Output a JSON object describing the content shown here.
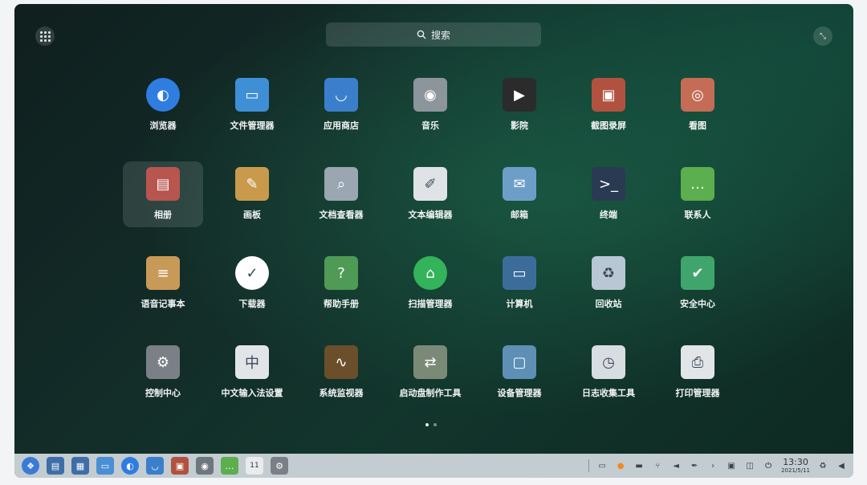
{
  "search": {
    "label": "搜索"
  },
  "apps": [
    {
      "id": "browser",
      "label": "浏览器",
      "icon": "browser-icon",
      "color": "#2f7de1"
    },
    {
      "id": "file-manager",
      "label": "文件管理器",
      "icon": "folder-icon",
      "color": "#3f8fd6"
    },
    {
      "id": "app-store",
      "label": "应用商店",
      "icon": "shopping-bag-icon",
      "color": "#3b7fcc"
    },
    {
      "id": "music",
      "label": "音乐",
      "icon": "disc-icon",
      "color": "#8d959c"
    },
    {
      "id": "movie",
      "label": "影院",
      "icon": "clapperboard-icon",
      "color": "#2b2b2b"
    },
    {
      "id": "screenshot",
      "label": "截图录屏",
      "icon": "screenshot-icon",
      "color": "#b0523f"
    },
    {
      "id": "image-viewer",
      "label": "看图",
      "icon": "image-viewer-icon",
      "color": "#c46c55"
    },
    {
      "id": "album",
      "label": "相册",
      "icon": "photo-album-icon",
      "color": "#b8554f",
      "selected": true
    },
    {
      "id": "draw",
      "label": "画板",
      "icon": "palette-icon",
      "color": "#c99a4c"
    },
    {
      "id": "doc-viewer",
      "label": "文档查看器",
      "icon": "document-search-icon",
      "color": "#9aa6b0"
    },
    {
      "id": "text-editor",
      "label": "文本编辑器",
      "icon": "text-editor-icon",
      "color": "#dfe3e6"
    },
    {
      "id": "mail",
      "label": "邮箱",
      "icon": "mail-icon",
      "color": "#6d9ec8"
    },
    {
      "id": "terminal",
      "label": "终端",
      "icon": "terminal-icon",
      "color": "#2a3a52"
    },
    {
      "id": "contacts",
      "label": "联系人",
      "icon": "chat-icon",
      "color": "#5cae4f"
    },
    {
      "id": "voice-note",
      "label": "语音记事本",
      "icon": "notepad-icon",
      "color": "#c89a58"
    },
    {
      "id": "downloader",
      "label": "下载器",
      "icon": "download-icon",
      "color": "#ffffff"
    },
    {
      "id": "help",
      "label": "帮助手册",
      "icon": "help-book-icon",
      "color": "#4f9a55"
    },
    {
      "id": "scanner",
      "label": "扫描管理器",
      "icon": "scanner-icon",
      "color": "#33b35a"
    },
    {
      "id": "computer",
      "label": "计算机",
      "icon": "monitor-icon",
      "color": "#3c6d9a"
    },
    {
      "id": "trash",
      "label": "回收站",
      "icon": "trash-icon",
      "color": "#b9c7d4"
    },
    {
      "id": "security",
      "label": "安全中心",
      "icon": "shield-check-icon",
      "color": "#3fa56c"
    },
    {
      "id": "control-center",
      "label": "控制中心",
      "icon": "gear-icon",
      "color": "#7b8086"
    },
    {
      "id": "input-method",
      "label": "中文输入法设置",
      "icon": "keyboard-icon",
      "color": "#e2e5e8"
    },
    {
      "id": "system-monitor",
      "label": "系统监视器",
      "icon": "system-monitor-icon",
      "color": "#6b4e2a"
    },
    {
      "id": "boot-maker",
      "label": "启动盘制作工具",
      "icon": "usb-icon",
      "color": "#7b8a76"
    },
    {
      "id": "device-manager",
      "label": "设备管理器",
      "icon": "device-icon",
      "color": "#5e8fb5"
    },
    {
      "id": "log-viewer",
      "label": "日志收集工具",
      "icon": "log-icon",
      "color": "#d8dde2"
    },
    {
      "id": "print-manager",
      "label": "打印管理器",
      "icon": "printer-icon",
      "color": "#e2e5e8"
    }
  ],
  "pager": {
    "count": 2,
    "active": 0
  },
  "dock": {
    "items": [
      {
        "icon": "launcher-icon",
        "color": "#3a7bd5"
      },
      {
        "icon": "multitask-icon",
        "color": "#3d6ea8"
      },
      {
        "icon": "workspace-icon",
        "color": "#3d6ea8"
      },
      {
        "icon": "folder-icon",
        "color": "#4a8fd4"
      },
      {
        "icon": "browser-icon",
        "color": "#2f7de1"
      },
      {
        "icon": "app-store-icon",
        "color": "#3b7fcc"
      },
      {
        "icon": "screenshot-icon",
        "color": "#b0523f"
      },
      {
        "icon": "music-icon",
        "color": "#6f777e"
      },
      {
        "icon": "chat-icon",
        "color": "#5cae4f"
      },
      {
        "icon": "calendar-icon",
        "color": "#e8ecef"
      },
      {
        "icon": "settings-icon",
        "color": "#7b8086"
      }
    ],
    "calendar_day": "11",
    "tray": [
      "screen-icon",
      "fire-icon",
      "keyboard-icon",
      "usb-icon",
      "volume-icon",
      "pen-icon",
      "chevron-right-icon",
      "window-icon",
      "cpu-icon",
      "power-icon"
    ],
    "clock_time": "13:30",
    "clock_date": "2021/5/11",
    "tray_end": [
      "trash-icon",
      "notification-icon"
    ]
  }
}
